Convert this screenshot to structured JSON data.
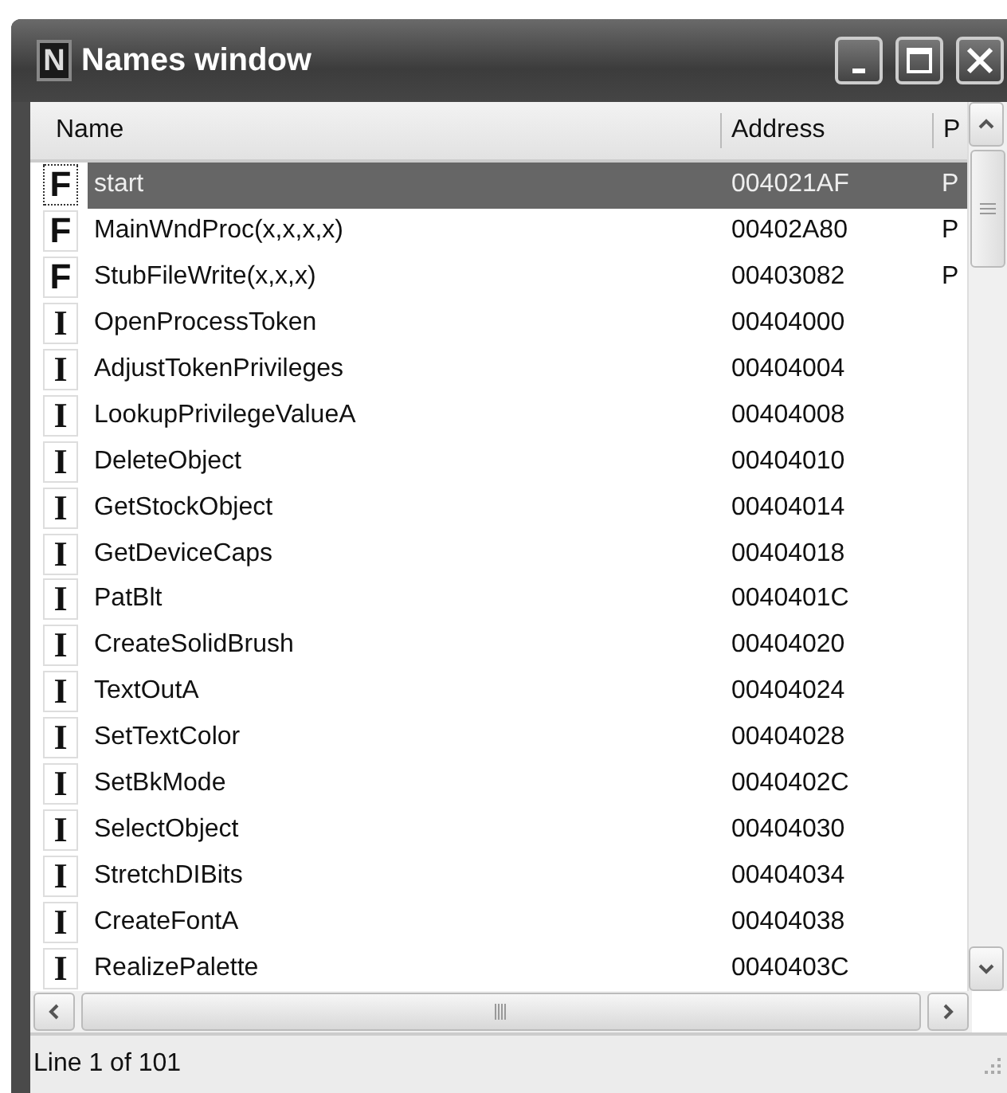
{
  "window": {
    "title": "Names window",
    "icon_letter": "N"
  },
  "columns": [
    "Name",
    "Address",
    "P"
  ],
  "rows": [
    {
      "kind": "function",
      "icon": "F",
      "name": "start",
      "address": "004021AF",
      "p": "P",
      "selected": true
    },
    {
      "kind": "function",
      "icon": "F",
      "name": "MainWndProc(x,x,x,x)",
      "address": "00402A80",
      "p": "P",
      "selected": false
    },
    {
      "kind": "function",
      "icon": "F",
      "name": "StubFileWrite(x,x,x)",
      "address": "00403082",
      "p": "P",
      "selected": false
    },
    {
      "kind": "import",
      "icon": "I",
      "name": "OpenProcessToken",
      "address": "00404000",
      "selected": false
    },
    {
      "kind": "import",
      "icon": "I",
      "name": "AdjustTokenPrivileges",
      "address": "00404004",
      "selected": false
    },
    {
      "kind": "import",
      "icon": "I",
      "name": "LookupPrivilegeValueA",
      "address": "00404008",
      "selected": false
    },
    {
      "kind": "import",
      "icon": "I",
      "name": "DeleteObject",
      "address": "00404010",
      "selected": false
    },
    {
      "kind": "import",
      "icon": "I",
      "name": "GetStockObject",
      "address": "00404014",
      "selected": false
    },
    {
      "kind": "import",
      "icon": "I",
      "name": "GetDeviceCaps",
      "address": "00404018",
      "selected": false
    },
    {
      "kind": "import",
      "icon": "I",
      "name": "PatBlt",
      "address": "0040401C",
      "selected": false
    },
    {
      "kind": "import",
      "icon": "I",
      "name": "CreateSolidBrush",
      "address": "00404020",
      "selected": false
    },
    {
      "kind": "import",
      "icon": "I",
      "name": "TextOutA",
      "address": "00404024",
      "selected": false
    },
    {
      "kind": "import",
      "icon": "I",
      "name": "SetTextColor",
      "address": "00404028",
      "selected": false
    },
    {
      "kind": "import",
      "icon": "I",
      "name": "SetBkMode",
      "address": "0040402C",
      "selected": false
    },
    {
      "kind": "import",
      "icon": "I",
      "name": "SelectObject",
      "address": "00404030",
      "selected": false
    },
    {
      "kind": "import",
      "icon": "I",
      "name": "StretchDIBits",
      "address": "00404034",
      "selected": false
    },
    {
      "kind": "import",
      "icon": "I",
      "name": "CreateFontA",
      "address": "00404038",
      "selected": false
    },
    {
      "kind": "import",
      "icon": "I",
      "name": "RealizePalette",
      "address": "0040403C",
      "selected": false
    }
  ],
  "status_bar": "Line 1 of 101"
}
